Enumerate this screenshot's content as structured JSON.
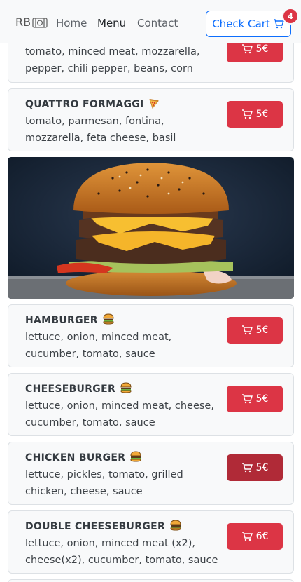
{
  "nav": {
    "brand": "RB",
    "brand_icon": "plate-cutlery-icon",
    "links": [
      "Home",
      "Menu",
      "Contact"
    ],
    "active": "Menu",
    "cart_label": "Check Cart",
    "cart_count": "4",
    "colors": {
      "primary": "#0d6efd",
      "danger": "#dc3545"
    }
  },
  "items": [
    {
      "name": "",
      "desc": "tomato, minced meat, mozzarella, pepper, chili pepper, beans, corn",
      "price": "5€"
    },
    {
      "name": "QUATTRO FORMAGGI",
      "emoji": "pizza",
      "desc": "tomato, parmesan, fontina, mozzarella, feta cheese, basil",
      "price": "5€"
    },
    {
      "name": "HAMBURGER",
      "emoji": "hamburger",
      "desc": "lettuce, onion, minced meat, cucumber, tomato, sauce",
      "price": "5€"
    },
    {
      "name": "CHEESEBURGER",
      "emoji": "hamburger",
      "desc": "lettuce, onion, minced meat, cheese, cucumber, tomato, sauce",
      "price": "5€"
    },
    {
      "name": "CHICKEN BURGER",
      "emoji": "hamburger",
      "desc": "lettuce, pickles, tomato, grilled chicken, cheese, sauce",
      "price": "5€"
    },
    {
      "name": "DOUBLE CHEESEBURGER",
      "emoji": "hamburger",
      "desc": "lettuce, onion, minced meat (x2), cheese(x2), cucumber, tomato, sauce",
      "price": "6€"
    }
  ]
}
